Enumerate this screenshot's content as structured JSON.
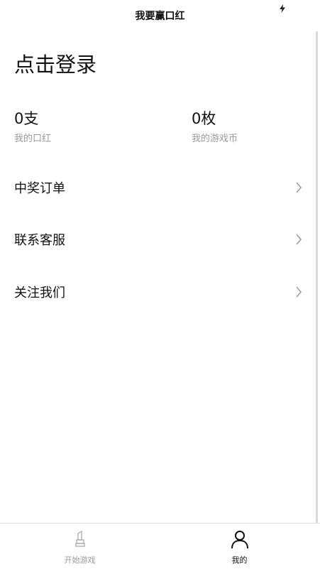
{
  "header": {
    "title": "我要赢口红",
    "status_icon": "bolt-icon"
  },
  "profile": {
    "login_text": "点击登录"
  },
  "stats": [
    {
      "value": "0支",
      "label": "我的口红"
    },
    {
      "value": "0枚",
      "label": "我的游戏币"
    }
  ],
  "menu": [
    {
      "label": "中奖订单",
      "icon": "chevron-right-icon"
    },
    {
      "label": "联系客服",
      "icon": "chevron-right-icon"
    },
    {
      "label": "关注我们",
      "icon": "chevron-right-icon"
    }
  ],
  "tabbar": {
    "tabs": [
      {
        "label": "开始游戏",
        "icon": "lipstick-icon",
        "active": false
      },
      {
        "label": "我的",
        "icon": "user-icon",
        "active": true
      }
    ]
  },
  "colors": {
    "text_primary": "#111111",
    "text_secondary": "#9a9a9a",
    "divider": "#dcdcdc",
    "background": "#ffffff"
  }
}
